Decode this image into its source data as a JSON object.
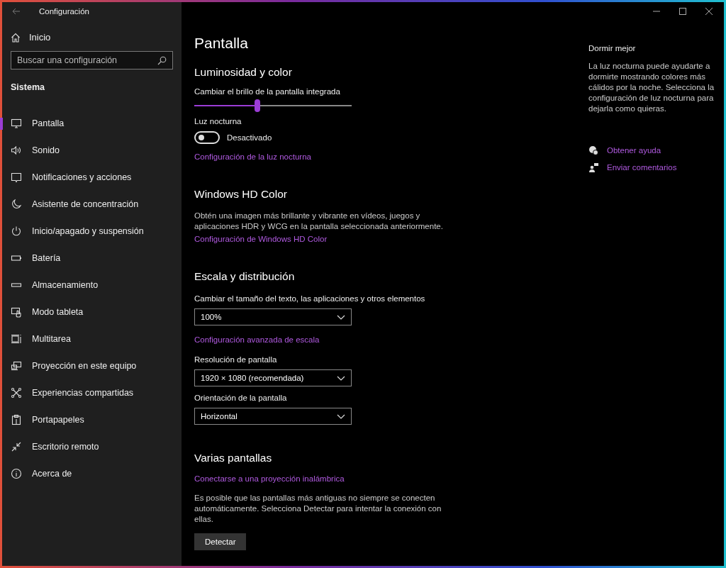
{
  "window": {
    "title": "Configuración"
  },
  "sidebar": {
    "home": {
      "label": "Inicio"
    },
    "search": {
      "placeholder": "Buscar una configuración"
    },
    "section": "Sistema",
    "items": [
      {
        "label": "Pantalla",
        "selected": true
      },
      {
        "label": "Sonido",
        "selected": false
      },
      {
        "label": "Notificaciones y acciones",
        "selected": false
      },
      {
        "label": "Asistente de concentración",
        "selected": false
      },
      {
        "label": "Inicio/apagado y suspensión",
        "selected": false
      },
      {
        "label": "Batería",
        "selected": false
      },
      {
        "label": "Almacenamiento",
        "selected": false
      },
      {
        "label": "Modo tableta",
        "selected": false
      },
      {
        "label": "Multitarea",
        "selected": false
      },
      {
        "label": "Proyección en este equipo",
        "selected": false
      },
      {
        "label": "Experiencias compartidas",
        "selected": false
      },
      {
        "label": "Portapapeles",
        "selected": false
      },
      {
        "label": "Escritorio remoto",
        "selected": false
      },
      {
        "label": "Acerca de",
        "selected": false
      }
    ]
  },
  "main": {
    "title": "Pantalla",
    "brightness": {
      "heading": "Luminosidad y color",
      "slider": {
        "label": "Cambiar el brillo de la pantalla integrada",
        "level": 0.4
      },
      "night_light": {
        "label": "Luz nocturna",
        "on": false,
        "state_text": "Desactivado"
      },
      "link": "Configuración de la luz nocturna"
    },
    "hd_color": {
      "heading": "Windows HD Color",
      "description": "Obtén una imagen más brillante y vibrante en vídeos, juegos y aplicaciones HDR y WCG en la pantalla seleccionada anteriormente.",
      "link": "Configuración de Windows HD Color"
    },
    "scale": {
      "heading": "Escala y distribución",
      "size": {
        "label": "Cambiar el tamaño del texto, las aplicaciones y otros elementos",
        "value": "100%"
      },
      "advanced_link": "Configuración avanzada de escala",
      "resolution": {
        "label": "Resolución de pantalla",
        "value": "1920 × 1080 (recomendada)"
      },
      "orientation": {
        "label": "Orientación de la pantalla",
        "value": "Horizontal"
      }
    },
    "multiple": {
      "heading": "Varias pantallas",
      "link": "Conectarse a una proyección inalámbrica",
      "description": "Es posible que las pantallas más antiguas no siempre se conecten automáticamente. Selecciona Detectar para intentar la conexión con ellas.",
      "button": "Detectar"
    }
  },
  "aside": {
    "heading": "Dormir mejor",
    "text": "La luz nocturna puede ayudarte a dormirte mostrando colores más cálidos por la noche. Selecciona la configuración de luz nocturna para dejarla como quieras.",
    "links": [
      {
        "label": "Obtener ayuda",
        "kind": "help"
      },
      {
        "label": "Enviar comentarios",
        "kind": "feedback"
      }
    ]
  }
}
